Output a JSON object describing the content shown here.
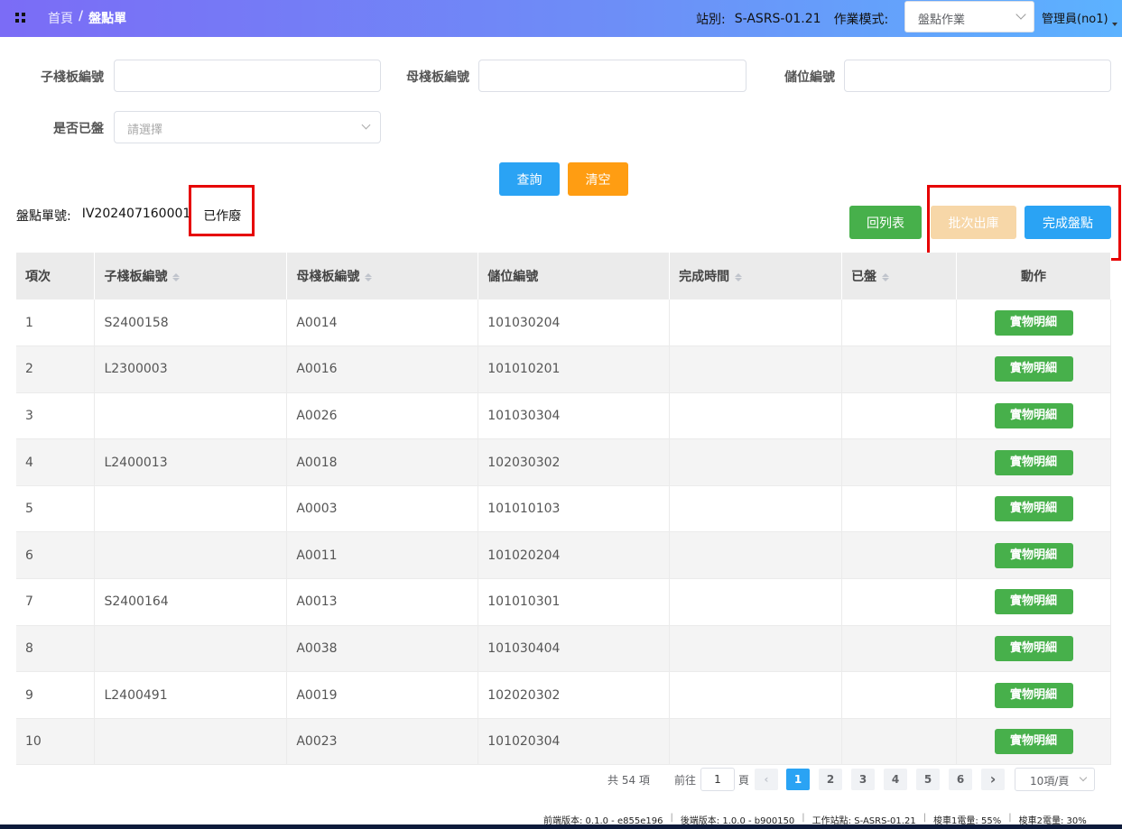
{
  "breadcrumb": {
    "home": "首頁",
    "separator": "/",
    "current": "盤點單"
  },
  "header": {
    "station_label": "站別:",
    "station_value": "S-ASRS-01.21",
    "mode_label": "作業模式:",
    "mode_value": "盤點作業",
    "user": "管理員(no1)"
  },
  "filters": {
    "child_board_label": "子棧板編號",
    "child_board_value": "",
    "parent_board_label": "母棧板編號",
    "parent_board_value": "",
    "storage_label": "儲位編號",
    "storage_value": "",
    "counted_label": "是否已盤",
    "counted_placeholder": "請選擇"
  },
  "actions": {
    "query": "查詢",
    "clear": "清空",
    "back_to_list": "回列表",
    "batch_outbound": "批次出庫",
    "complete_count": "完成盤點"
  },
  "order": {
    "label": "盤點單號:",
    "number": "IV202407160001",
    "status": "已作廢"
  },
  "table": {
    "headers": [
      "項次",
      "子棧板編號",
      "母棧板編號",
      "儲位編號",
      "完成時間",
      "已盤",
      "動作"
    ],
    "action_label": "實物明細",
    "rows": [
      [
        "1",
        "S2400158",
        "A0014",
        "101030204",
        "",
        ""
      ],
      [
        "2",
        "L2300003",
        "A0016",
        "101010201",
        "",
        ""
      ],
      [
        "3",
        "",
        "A0026",
        "101030304",
        "",
        ""
      ],
      [
        "4",
        "L2400013",
        "A0018",
        "102030302",
        "",
        ""
      ],
      [
        "5",
        "",
        "A0003",
        "101010103",
        "",
        ""
      ],
      [
        "6",
        "",
        "A0011",
        "101020204",
        "",
        ""
      ],
      [
        "7",
        "S2400164",
        "A0013",
        "101010301",
        "",
        ""
      ],
      [
        "8",
        "",
        "A0038",
        "101030404",
        "",
        ""
      ],
      [
        "9",
        "L2400491",
        "A0019",
        "102020302",
        "",
        ""
      ],
      [
        "10",
        "",
        "A0023",
        "101020304",
        "",
        ""
      ]
    ]
  },
  "pagination": {
    "total": "共 54 項",
    "goto_prefix": "前往",
    "goto_value": "1",
    "goto_suffix": "頁",
    "pages": [
      "1",
      "2",
      "3",
      "4",
      "5",
      "6"
    ],
    "current_page": "1",
    "page_size": "10項/頁"
  },
  "footer": {
    "frontend": "前端版本: 0.1.0 - e855e196",
    "backend": "後端版本: 1.0.0 - b900150",
    "station": "工作站點: S-ASRS-01.21",
    "shuttle1": "梭車1電量: 55%",
    "shuttle2": "梭車2電量: 30%"
  },
  "colors": {
    "primary": "#2aa3f4",
    "success": "#47b04b",
    "warning": "#ff9d12",
    "highlight": "#e60000"
  }
}
